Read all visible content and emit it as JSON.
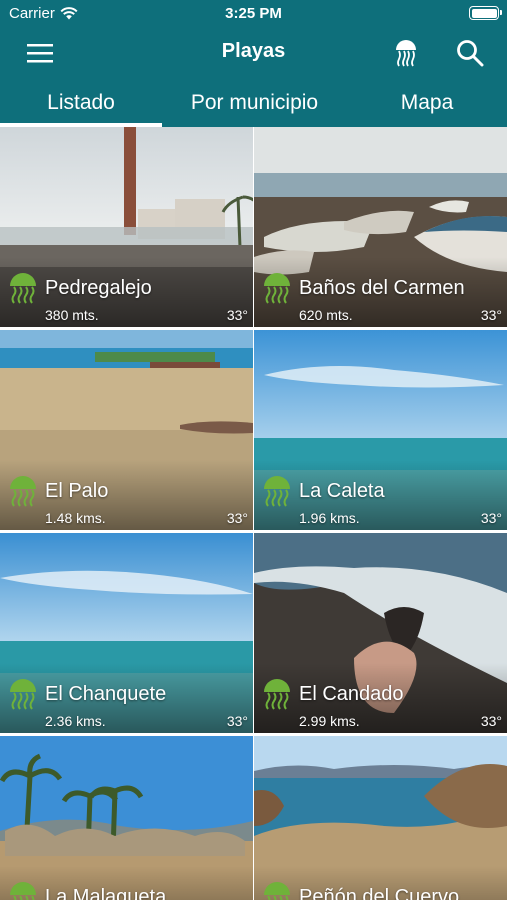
{
  "status": {
    "carrier": "Carrier",
    "time": "3:25 PM"
  },
  "nav": {
    "title": "Playas"
  },
  "tabs": [
    {
      "label": "Listado",
      "active": true
    },
    {
      "label": "Por municipio",
      "active": false
    },
    {
      "label": "Mapa",
      "active": false
    }
  ],
  "beaches": [
    {
      "name": "Pedregalejo",
      "distance": "380 mts.",
      "temp": "33°"
    },
    {
      "name": "Baños del Carmen",
      "distance": "620 mts.",
      "temp": "33°"
    },
    {
      "name": "El Palo",
      "distance": "1.48 kms.",
      "temp": "33°"
    },
    {
      "name": "La Caleta",
      "distance": "1.96 kms.",
      "temp": "33°"
    },
    {
      "name": "El Chanquete",
      "distance": "2.36 kms.",
      "temp": "33°"
    },
    {
      "name": "El Candado",
      "distance": "2.99 kms.",
      "temp": "33°"
    },
    {
      "name": "La Malagueta",
      "distance": "",
      "temp": ""
    },
    {
      "name": "Peñón del Cuervo",
      "distance": "",
      "temp": ""
    }
  ],
  "icons": {
    "jellyfish": "jellyfish-icon",
    "menu": "menu-icon",
    "search": "search-icon",
    "wifi": "wifi-icon",
    "battery": "battery-icon"
  },
  "colors": {
    "header": "#0e6f7b",
    "jellyfish": "#6fb23a"
  }
}
